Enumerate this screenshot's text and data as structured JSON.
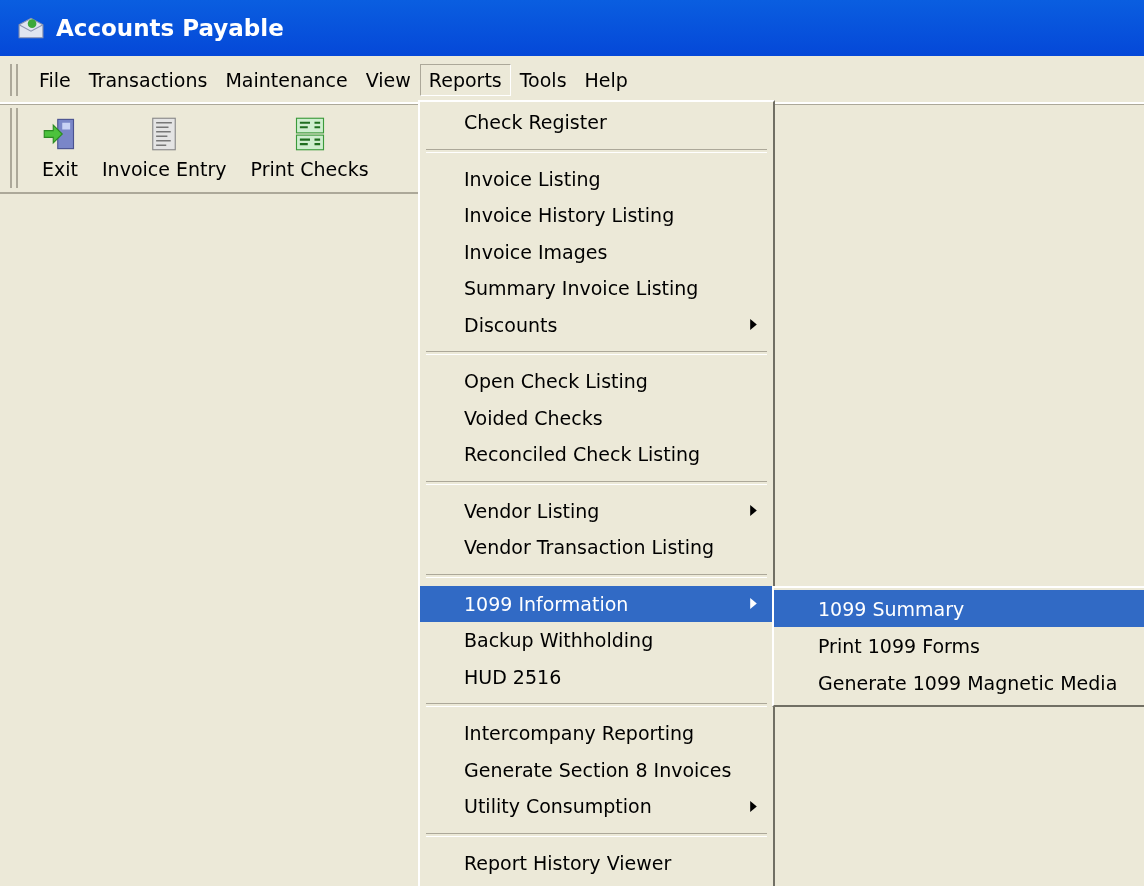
{
  "window": {
    "title": "Accounts Payable"
  },
  "menubar": [
    {
      "label": "File",
      "selected": false
    },
    {
      "label": "Transactions",
      "selected": false
    },
    {
      "label": "Maintenance",
      "selected": false
    },
    {
      "label": "View",
      "selected": false
    },
    {
      "label": "Reports",
      "selected": true
    },
    {
      "label": "Tools",
      "selected": false
    },
    {
      "label": "Help",
      "selected": false
    }
  ],
  "toolbar": [
    {
      "label": "Exit",
      "kind": "exit"
    },
    {
      "label": "Invoice Entry",
      "kind": "invoice"
    },
    {
      "label": "Print Checks",
      "kind": "checks"
    }
  ],
  "reports_menu": [
    [
      {
        "label": "Check Register",
        "selected": false,
        "submenu": false
      }
    ],
    [
      {
        "label": "Invoice Listing",
        "selected": false,
        "submenu": false
      },
      {
        "label": "Invoice History Listing",
        "selected": false,
        "submenu": false
      },
      {
        "label": "Invoice Images",
        "selected": false,
        "submenu": false
      },
      {
        "label": "Summary Invoice Listing",
        "selected": false,
        "submenu": false
      },
      {
        "label": "Discounts",
        "selected": false,
        "submenu": true
      }
    ],
    [
      {
        "label": "Open Check Listing",
        "selected": false,
        "submenu": false
      },
      {
        "label": "Voided Checks",
        "selected": false,
        "submenu": false
      },
      {
        "label": "Reconciled Check Listing",
        "selected": false,
        "submenu": false
      }
    ],
    [
      {
        "label": "Vendor Listing",
        "selected": false,
        "submenu": true
      },
      {
        "label": "Vendor Transaction Listing",
        "selected": false,
        "submenu": false
      }
    ],
    [
      {
        "label": "1099 Information",
        "selected": true,
        "submenu": true
      },
      {
        "label": "Backup Withholding",
        "selected": false,
        "submenu": false
      },
      {
        "label": "HUD 2516",
        "selected": false,
        "submenu": false
      }
    ],
    [
      {
        "label": "Intercompany Reporting",
        "selected": false,
        "submenu": false
      },
      {
        "label": "Generate Section 8 Invoices",
        "selected": false,
        "submenu": false
      },
      {
        "label": "Utility Consumption",
        "selected": false,
        "submenu": true
      }
    ],
    [
      {
        "label": "Report History Viewer",
        "selected": false,
        "submenu": false
      }
    ]
  ],
  "submenu_1099": [
    {
      "label": "1099 Summary",
      "selected": true
    },
    {
      "label": "Print 1099 Forms",
      "selected": false
    },
    {
      "label": "Generate 1099 Magnetic Media",
      "selected": false
    }
  ]
}
